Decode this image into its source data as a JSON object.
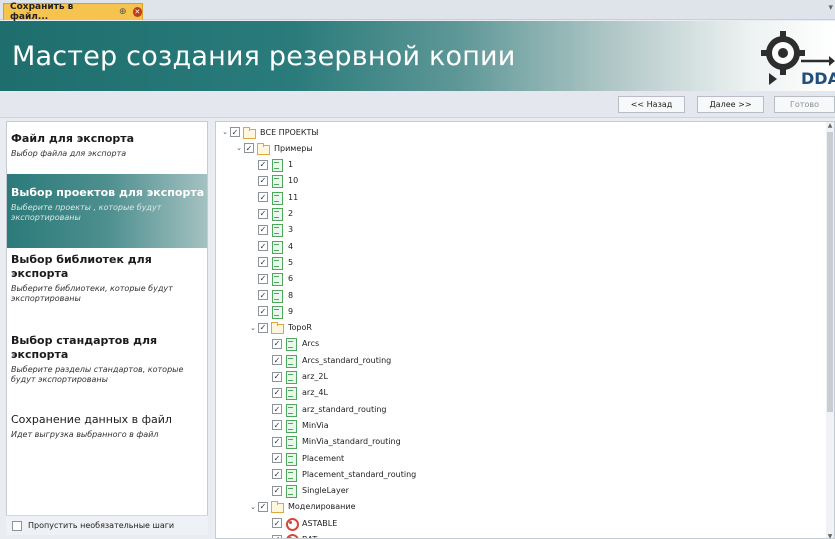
{
  "tab": {
    "title": "Сохранить в файл...",
    "pin": "⊕",
    "close": "✕",
    "menu": "▾"
  },
  "banner": {
    "title": "Мастер создания резервной копии",
    "logo_text": "DDA"
  },
  "nav": {
    "back": "<< Назад",
    "next": "Далее >>",
    "finish": "Готово"
  },
  "steps": [
    {
      "title": "Файл для экспорта",
      "desc": "Выбор файла для экспорта"
    },
    {
      "title": "Выбор проектов для экспорта",
      "desc": "Выберите проекты , которые будут экспортированы"
    },
    {
      "title": "Выбор библиотек для экспорта",
      "desc": "Выберите библиотеки, которые будут экспортированы"
    },
    {
      "title": "Выбор стандартов для экспорта",
      "desc": "Выберите разделы стандартов, которые будут экспортированы"
    },
    {
      "title": "Сохранение данных в файл",
      "desc": "Идет выгрузка выбранного в файл"
    }
  ],
  "skip_label": "Пропустить необязательные шаги",
  "tree": [
    {
      "label": "ВСЕ ПРОЕКТЫ",
      "level": 0,
      "icon": "folder",
      "expanded": true,
      "checked": true
    },
    {
      "label": "Примеры",
      "level": 1,
      "icon": "folder",
      "expanded": true,
      "checked": true
    },
    {
      "label": "1",
      "level": 2,
      "icon": "proj",
      "checked": true
    },
    {
      "label": "10",
      "level": 2,
      "icon": "proj",
      "checked": true
    },
    {
      "label": "11",
      "level": 2,
      "icon": "proj",
      "checked": true
    },
    {
      "label": "2",
      "level": 2,
      "icon": "proj",
      "checked": true
    },
    {
      "label": "3",
      "level": 2,
      "icon": "proj",
      "checked": true
    },
    {
      "label": "4",
      "level": 2,
      "icon": "proj",
      "checked": true
    },
    {
      "label": "5",
      "level": 2,
      "icon": "proj",
      "checked": true
    },
    {
      "label": "6",
      "level": 2,
      "icon": "proj",
      "checked": true
    },
    {
      "label": "8",
      "level": 2,
      "icon": "proj",
      "checked": true
    },
    {
      "label": "9",
      "level": 2,
      "icon": "proj",
      "checked": true
    },
    {
      "label": "TopoR",
      "level": 2,
      "icon": "folder",
      "expanded": true,
      "checked": true
    },
    {
      "label": "Arcs",
      "level": 3,
      "icon": "proj",
      "checked": true
    },
    {
      "label": "Arcs_standard_routing",
      "level": 3,
      "icon": "proj",
      "checked": true
    },
    {
      "label": "arz_2L",
      "level": 3,
      "icon": "proj",
      "checked": true
    },
    {
      "label": "arz_4L",
      "level": 3,
      "icon": "proj",
      "checked": true
    },
    {
      "label": "arz_standard_routing",
      "level": 3,
      "icon": "proj",
      "checked": true
    },
    {
      "label": "MinVia",
      "level": 3,
      "icon": "proj",
      "checked": true
    },
    {
      "label": "MinVia_standard_routing",
      "level": 3,
      "icon": "proj",
      "checked": true
    },
    {
      "label": "Placement",
      "level": 3,
      "icon": "proj",
      "checked": true
    },
    {
      "label": "Placement_standard_routing",
      "level": 3,
      "icon": "proj",
      "checked": true
    },
    {
      "label": "SingleLayer",
      "level": 3,
      "icon": "proj",
      "checked": true
    },
    {
      "label": "Моделирование",
      "level": 2,
      "icon": "folder",
      "expanded": true,
      "checked": true
    },
    {
      "label": "ASTABLE",
      "level": 3,
      "icon": "sim",
      "checked": true
    },
    {
      "label": "BAT",
      "level": 3,
      "icon": "sim",
      "checked": true
    }
  ],
  "check_glyph": "✓",
  "expand_glyph": "⌄",
  "colors": {
    "accent": "#2b7a7a",
    "tab": "#f6c34f"
  }
}
